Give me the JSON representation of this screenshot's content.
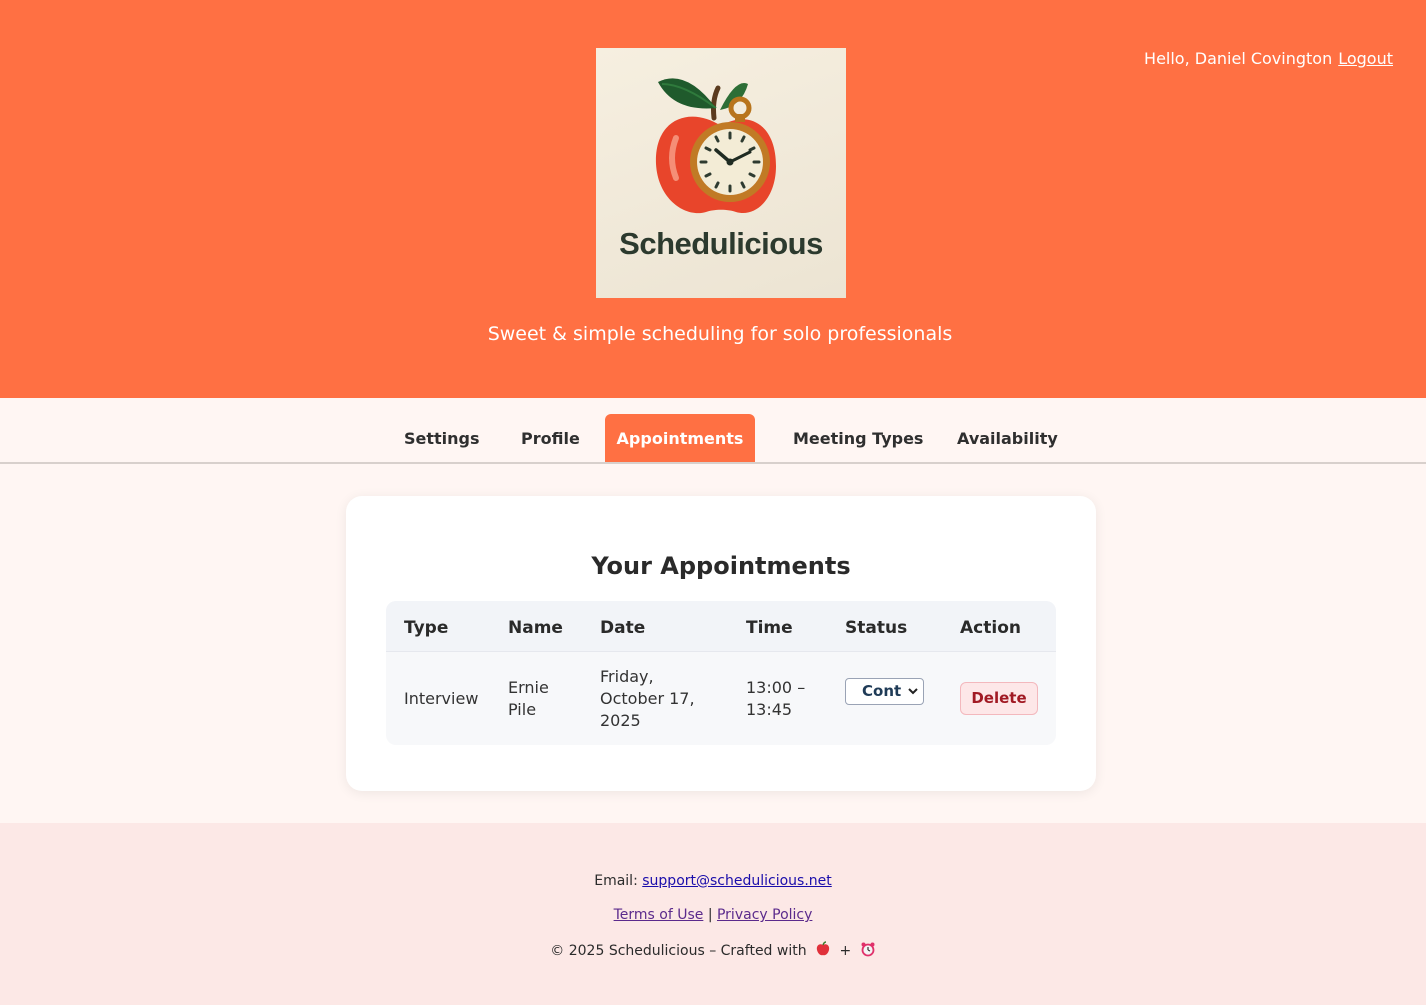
{
  "header": {
    "brand": "Schedulicious",
    "tagline": "Sweet & simple scheduling for solo professionals",
    "greeting": "Hello, Daniel Covington",
    "logout": "Logout"
  },
  "nav": {
    "tabs": [
      {
        "label": "Settings",
        "active": false
      },
      {
        "label": "Profile",
        "active": false
      },
      {
        "label": "Appointments",
        "active": true
      },
      {
        "label": "Meeting Types",
        "active": false
      },
      {
        "label": "Availability",
        "active": false
      }
    ]
  },
  "appointments": {
    "title": "Your Appointments",
    "columns": [
      "Type",
      "Name",
      "Date",
      "Time",
      "Status",
      "Action"
    ],
    "rows": [
      {
        "type": "Interview",
        "name_line1": "Ernie",
        "name_line2": "Pile",
        "date_line1": "Friday,",
        "date_line2": "October 17,",
        "date_line3": "2025",
        "time_line1": "13:00 –",
        "time_line2": "13:45",
        "status": "Cont",
        "action": "Delete"
      }
    ]
  },
  "footer": {
    "email_label": "Email:",
    "email": "support@schedulicious.net",
    "terms": "Terms of Use",
    "separator": "|",
    "privacy": "Privacy Policy",
    "copyright": "© 2025 Schedulicious – Crafted with",
    "plus": "+"
  },
  "colors": {
    "accent": "#ff7043",
    "page_bg": "#fff6f3",
    "footer_bg": "#fce8e6",
    "delete_text": "#a11a24"
  }
}
